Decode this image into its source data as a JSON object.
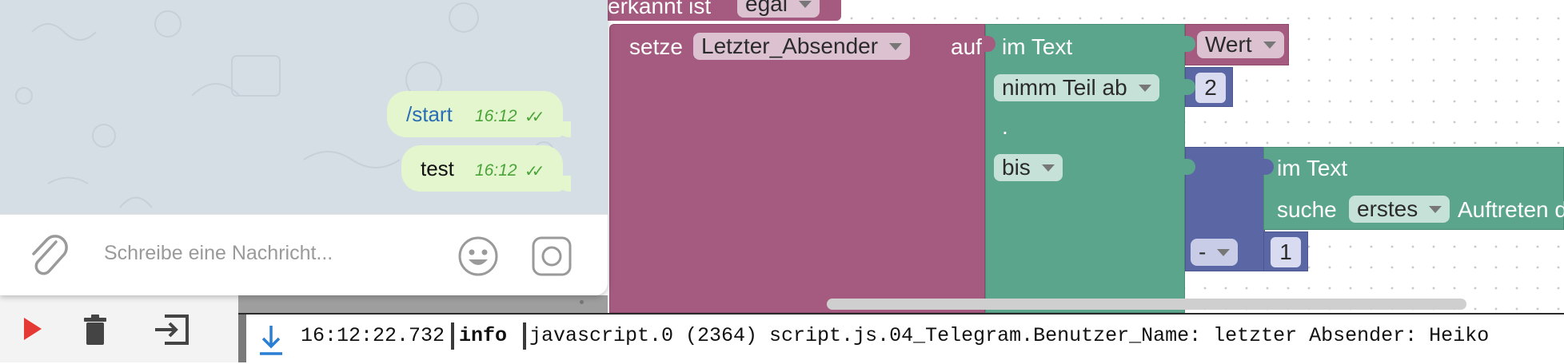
{
  "chat": {
    "messages": [
      {
        "text": "/start",
        "time": "16:12",
        "ticks": "✓✓"
      },
      {
        "text": "test",
        "time": "16:12",
        "ticks": "✓✓"
      }
    ],
    "composer_placeholder": "Schreibe eine Nachricht..."
  },
  "blocks": {
    "top_label": "erkannt ist",
    "top_dropdown": "egal",
    "set_label": "setze",
    "set_var": "Letzter_Absender",
    "set_to": "auf",
    "text_label": "im Text",
    "wert": "Wert",
    "substring_mode": "nimm Teil ab",
    "from_num": "2",
    "dot": ".",
    "to_mode": "bis",
    "inner_text_label": "im Text",
    "search_label": "suche",
    "search_mode": "erstes",
    "search_rest": "Auftreten d",
    "op": "-",
    "one": "1"
  },
  "log": {
    "time": "16:12:22.732",
    "level": "info",
    "message": "javascript.0 (2364) script.js.04_Telegram.Benutzer_Name: letzter Absender: Heiko"
  },
  "colors": {
    "variables_block": "#a55b80",
    "text_block": "#5ba58c",
    "math_block": "#5b67a5",
    "play": "#e53935"
  },
  "icons": [
    "paperclip-icon",
    "smiley-icon",
    "camera-icon",
    "play-icon",
    "trash-icon",
    "export-icon",
    "download-icon"
  ]
}
